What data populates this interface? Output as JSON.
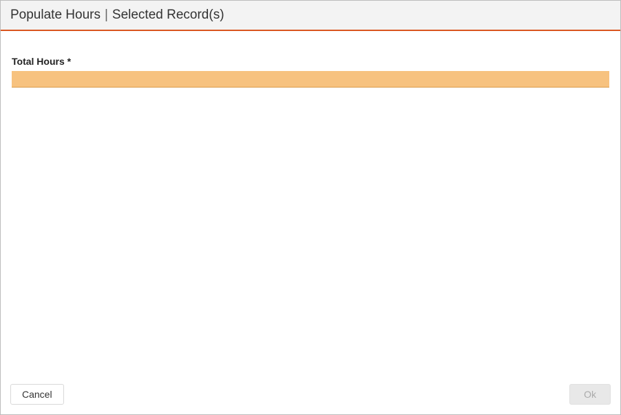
{
  "header": {
    "title_left": "Populate Hours",
    "title_right": "Selected Record(s)"
  },
  "form": {
    "total_hours_label": "Total Hours *",
    "total_hours_value": ""
  },
  "footer": {
    "cancel_label": "Cancel",
    "ok_label": "Ok"
  }
}
